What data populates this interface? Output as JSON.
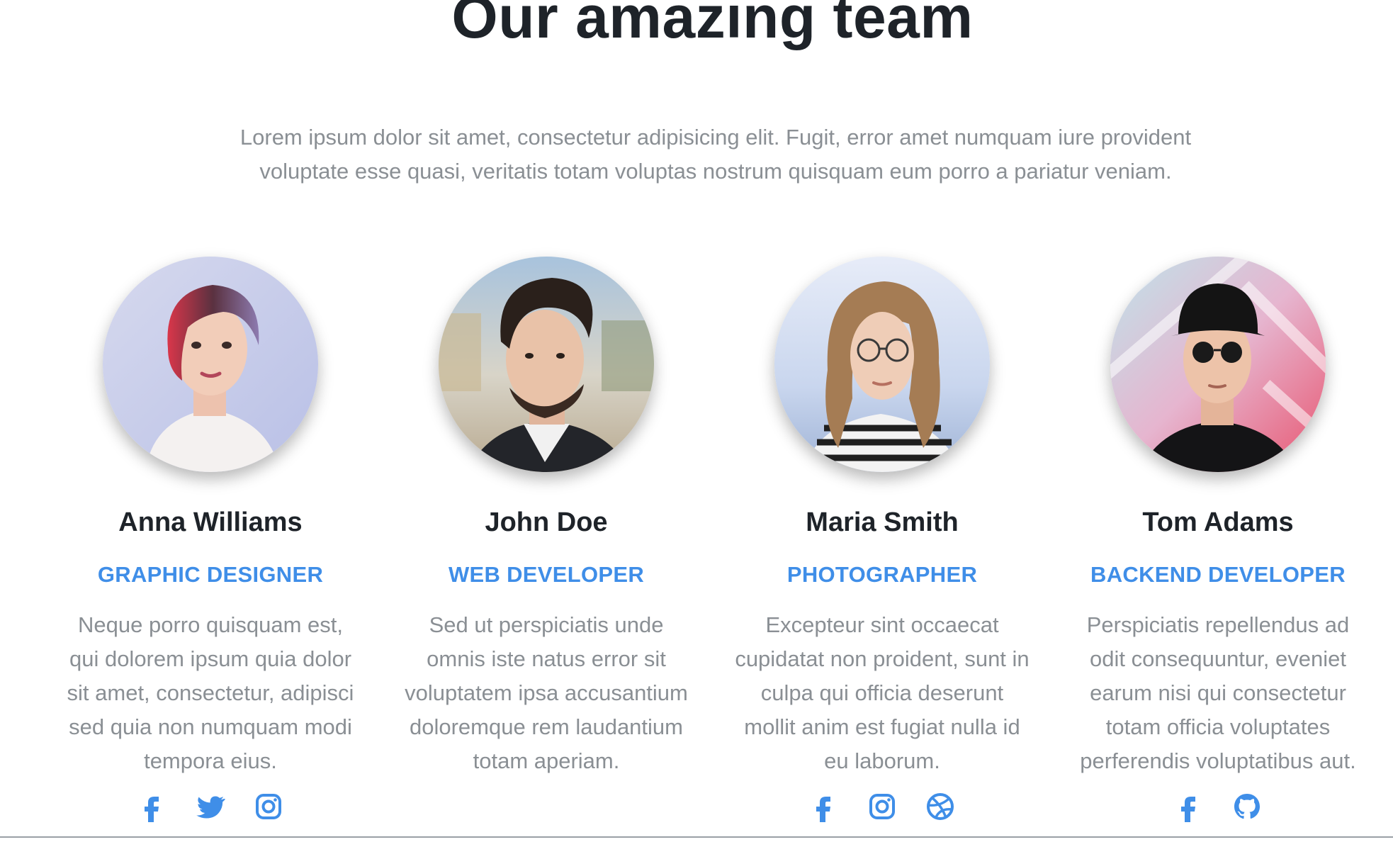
{
  "section": {
    "title": "Our amazing team",
    "intro": "Lorem ipsum dolor sit amet, consectetur adipisicing elit. Fugit, error amet numquam iure provident voluptate esse quasi, veritatis totam voluptas nostrum quisquam eum porro a pariatur veniam."
  },
  "colors": {
    "accent": "#3f8ee8",
    "heading": "#1e2329",
    "muted": "#8a8f94"
  },
  "team": [
    {
      "name": "Anna Williams",
      "role": "GRAPHIC DESIGNER",
      "bio": "Neque porro quisquam est, qui dolorem ipsum quia dolor sit amet, consectetur, adipisci sed quia non numquam modi tempora eius.",
      "socials": [
        "facebook-icon",
        "twitter-icon",
        "instagram-icon"
      ]
    },
    {
      "name": "John Doe",
      "role": "WEB DEVELOPER",
      "bio": "Sed ut perspiciatis unde omnis iste natus error sit voluptatem ipsa accusantium doloremque rem laudantium totam aperiam.",
      "socials": []
    },
    {
      "name": "Maria Smith",
      "role": "PHOTOGRAPHER",
      "bio": "Excepteur sint occaecat cupidatat non proident, sunt in culpa qui officia deserunt mollit anim est fugiat nulla id eu laborum.",
      "socials": [
        "facebook-icon",
        "instagram-icon",
        "dribbble-icon"
      ]
    },
    {
      "name": "Tom Adams",
      "role": "BACKEND DEVELOPER",
      "bio": "Perspiciatis repellendus ad odit consequuntur, eveniet earum nisi qui consectetur totam officia voluptates perferendis voluptatibus aut.",
      "socials": [
        "facebook-icon",
        "github-icon"
      ]
    }
  ]
}
